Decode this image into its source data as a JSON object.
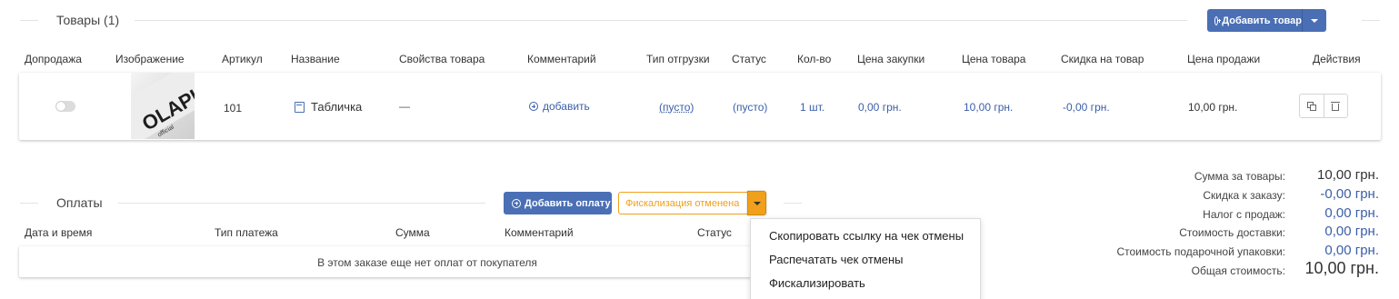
{
  "products": {
    "title": "Товары (1)",
    "add_button": "Добавить товар",
    "columns": [
      "Допродажа",
      "Изображение",
      "Артикул",
      "Название",
      "Свойства товара",
      "Комментарий",
      "Тип отгрузки",
      "Статус",
      "Кол-во",
      "Цена закупки",
      "Цена товара",
      "Скидка на товар",
      "Цена продажи",
      "Действия"
    ],
    "row": {
      "upsell_toggle": "off",
      "image_alt": "OLAPLEX",
      "sku": "101",
      "name": "Табличка",
      "properties": "—",
      "comment_link": "добавить",
      "shipment_type": "(пусто)",
      "status": "(пусто)",
      "qty": "1 шт.",
      "purchase_price": "0,00 грн.",
      "item_price": "10,00 грн.",
      "item_discount": "-0,00 грн.",
      "sale_price": "10,00 грн."
    }
  },
  "payments": {
    "title": "Оплаты",
    "add_button": "Добавить оплату",
    "fiscal_status": "Фискализация отменена",
    "columns": [
      "Дата и время",
      "Тип платежа",
      "Сумма",
      "Комментарий",
      "Статус"
    ],
    "empty_message": "В этом заказе еще нет оплат от покупателя"
  },
  "fiscal_menu": {
    "items": [
      "Скопировать ссылку на чек отмены",
      "Распечатать чек отмены",
      "Фискализировать"
    ]
  },
  "summary": {
    "rows": [
      {
        "label": "Сумма за товары:",
        "value": "10,00 грн."
      },
      {
        "label": "Скидка к заказу:",
        "value": "-0,00 грн."
      },
      {
        "label": "Налог с продаж:",
        "value": "0,00 грн."
      },
      {
        "label": "Стоимость доставки:",
        "value": "0,00 грн."
      },
      {
        "label": "Стоимость подарочной упаковки:",
        "value": "0,00 грн."
      },
      {
        "label": "Общая стоимость:",
        "value": "10,00 грн."
      }
    ]
  },
  "colors": {
    "primary": "#4a6fb5",
    "link": "#3b5ea8",
    "warning": "#f0a01a"
  }
}
